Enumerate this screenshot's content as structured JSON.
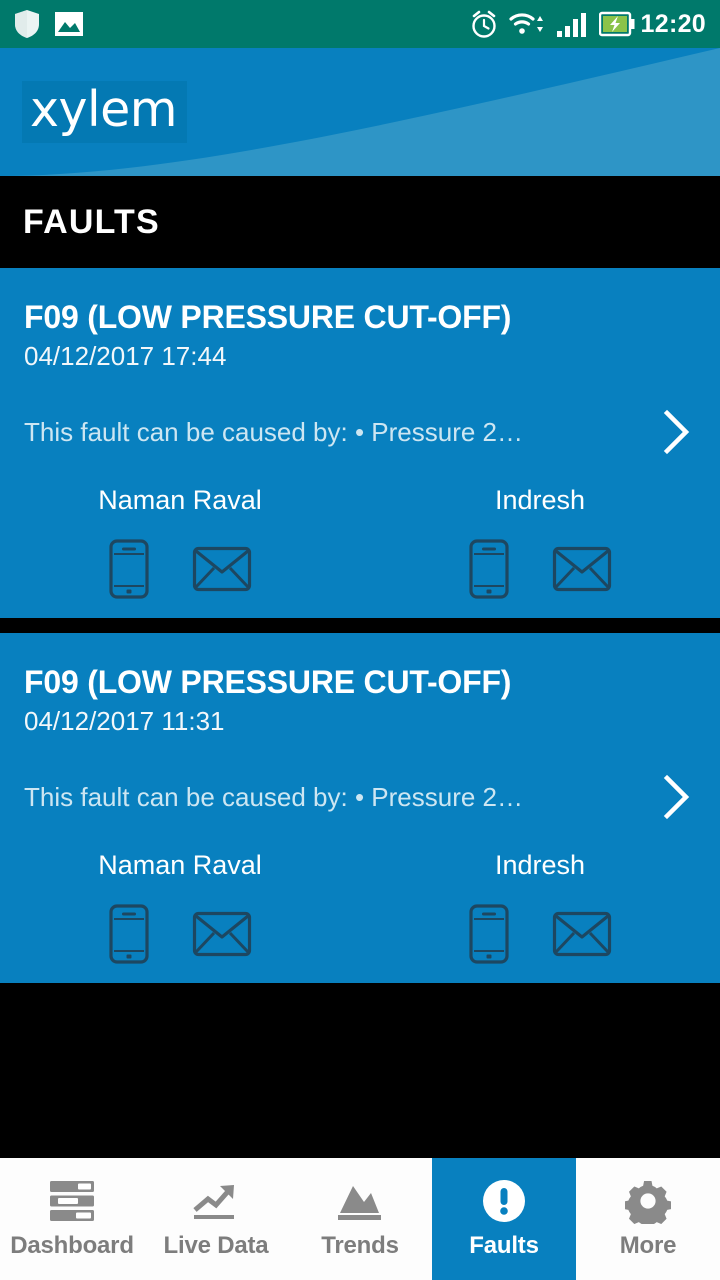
{
  "status_bar": {
    "time": "12:20",
    "icons": [
      "shield-icon",
      "photo-icon",
      "alarm-icon",
      "wifi-icon",
      "signal-icon",
      "battery-charging-icon"
    ]
  },
  "banner": {
    "logo_text": "xylem",
    "background_color": "#0880bf",
    "curve_color": "#2e95c6"
  },
  "title_bar": {
    "title": "FAULTS"
  },
  "faults": [
    {
      "code_title": "F09 (LOW PRESSURE CUT-OFF)",
      "timestamp": "04/12/2017 17:44",
      "description": "This fault can be caused by: • Pressure 2…",
      "chevron": "chevron-right-icon",
      "contacts": [
        {
          "name": "Naman Raval",
          "actions": [
            "phone-icon",
            "email-icon"
          ]
        },
        {
          "name": "Indresh",
          "actions": [
            "phone-icon",
            "email-icon"
          ]
        }
      ]
    },
    {
      "code_title": "F09 (LOW PRESSURE CUT-OFF)",
      "timestamp": "04/12/2017 11:31",
      "description": "This fault can be caused by: • Pressure 2…",
      "chevron": "chevron-right-icon",
      "contacts": [
        {
          "name": "Naman Raval",
          "actions": [
            "phone-icon",
            "email-icon"
          ]
        },
        {
          "name": "Indresh",
          "actions": [
            "phone-icon",
            "email-icon"
          ]
        }
      ]
    }
  ],
  "bottom_nav": {
    "active": "Faults",
    "items": [
      {
        "label": "Dashboard",
        "icon": "dashboard-icon"
      },
      {
        "label": "Live Data",
        "icon": "trending-up-icon"
      },
      {
        "label": "Trends",
        "icon": "mountain-chart-icon"
      },
      {
        "label": "Faults",
        "icon": "alert-circle-icon"
      },
      {
        "label": "More",
        "icon": "gear-icon"
      }
    ]
  },
  "colors": {
    "status_bar": "#00796b",
    "brand_blue": "#0880bf",
    "separator_black": "#000000",
    "nav_background": "#fdfdfd",
    "nav_inactive_text": "#7d7d7d",
    "icon_dark": "#1d4761"
  }
}
